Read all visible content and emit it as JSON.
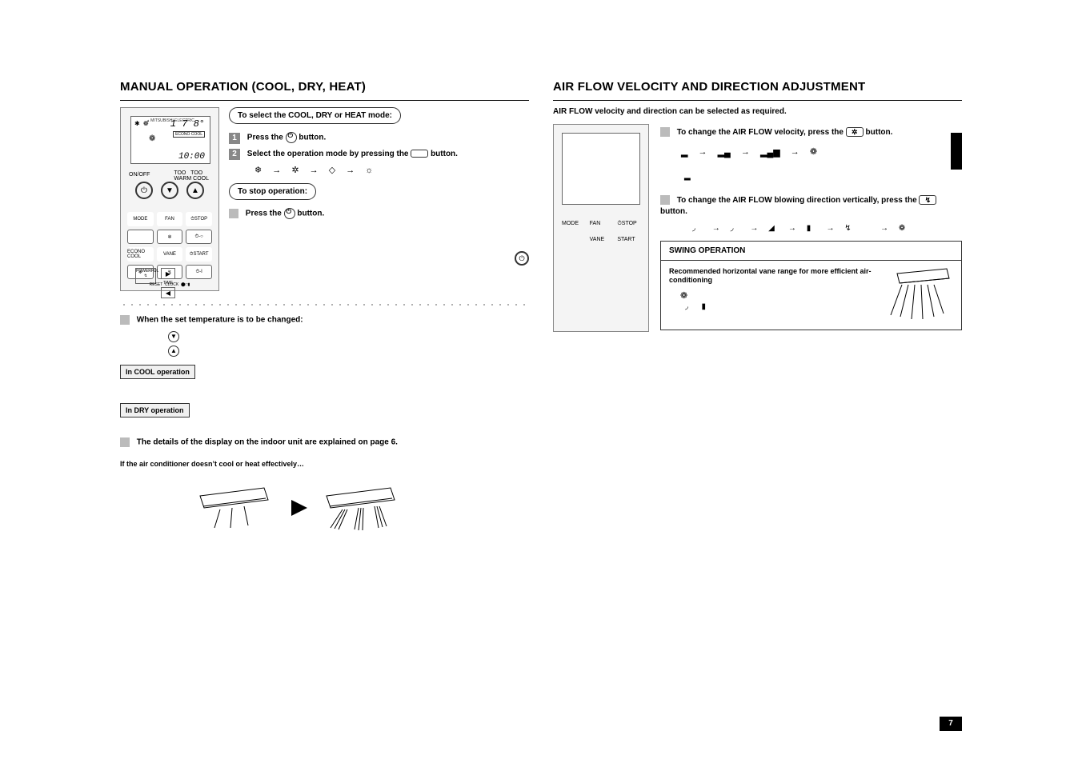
{
  "page_number": "7",
  "left": {
    "title": "MANUAL OPERATION (COOL, DRY, HEAT)",
    "pill_select": "To select the COOL, DRY or HEAT mode:",
    "step1": "Press the",
    "step1_after": "button.",
    "step2": "Select the operation mode by pressing the",
    "step2_after": "button.",
    "mode_cycle": {
      "a": "❄",
      "b": "☼",
      "c": "△",
      "d": "☀"
    },
    "pill_stop": "To stop operation:",
    "stop_step": "Press the",
    "stop_after": "button.",
    "temp_change_heading": "When the set temperature is to be changed:",
    "in_cool": "In COOL operation",
    "in_dry": "In DRY operation",
    "details_note": "The details of the display on the indoor unit are explained on page 6.",
    "effective_note": "If the air conditioner doesn’t cool or heat effectively…",
    "remote": {
      "brand": "MITSUBISHI ELECTRIC",
      "row1": "✱ ❁",
      "temp": "1 7 8°",
      "auto_lbl": "ECONO COOL",
      "clock": "10:00",
      "onoff": "ON/OFF",
      "too_warm": "TOO\nWARM",
      "too_cool": "TOO\nCOOL",
      "mode": "MODE",
      "fan": "FAN",
      "stop": "⏱STOP",
      "econocool": "ECONO COOL",
      "vane": "VANE",
      "start": "⏱START",
      "powerful": "POWERFUL",
      "time": "TIME",
      "reset": "RESET  CLOCK"
    }
  },
  "right": {
    "title": "AIR FLOW VELOCITY AND DIRECTION ADJUSTMENT",
    "intro": "AIR FLOW velocity and direction can be selected as required.",
    "step_velocity": "To change the AIR FLOW velocity, press the",
    "step_velocity_after": "button.",
    "fan_btn_glyph": "✲",
    "step_direction": "To change the AIR FLOW blowing direction vertically, press the",
    "step_direction_after": "button.",
    "vane_btn_glyph": "↯",
    "swing_title": "SWING OPERATION",
    "swing_text": "Recommended horizontal vane range for more efficient air-conditioning",
    "remote": {
      "mode": "MODE",
      "fan": "FAN",
      "stop": "⏱STOP",
      "vane": "VANE",
      "start": "START"
    }
  }
}
